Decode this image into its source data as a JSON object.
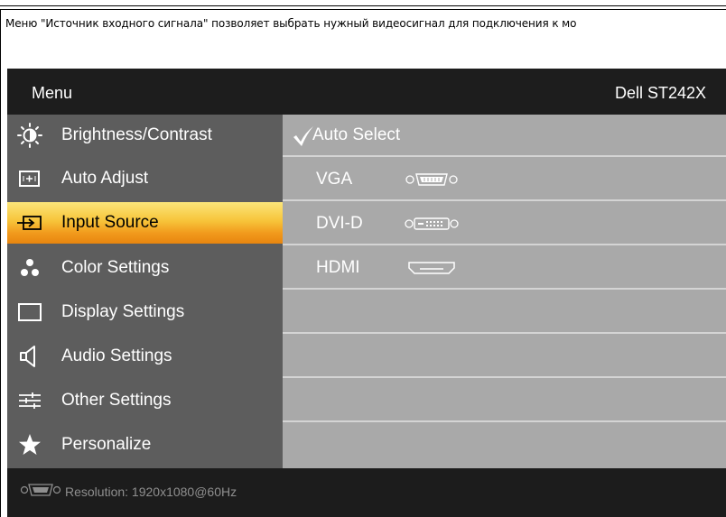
{
  "caption": "Меню \"Источник входного сигнала\" позволяет выбрать нужный видеосигнал для подключения к мо",
  "osd": {
    "header": {
      "title": "Menu",
      "model": "Dell ST242X"
    },
    "menu": [
      {
        "label": "Brightness/Contrast",
        "icon": "brightness-icon",
        "active": false
      },
      {
        "label": "Auto Adjust",
        "icon": "auto-adjust-icon",
        "active": false
      },
      {
        "label": "Input Source",
        "icon": "input-source-icon",
        "active": true
      },
      {
        "label": "Color Settings",
        "icon": "color-settings-icon",
        "active": false
      },
      {
        "label": "Display Settings",
        "icon": "display-settings-icon",
        "active": false
      },
      {
        "label": "Audio Settings",
        "icon": "speaker-icon",
        "active": false
      },
      {
        "label": "Other Settings",
        "icon": "sliders-icon",
        "active": false
      },
      {
        "label": "Personalize",
        "icon": "star-icon",
        "active": false
      }
    ],
    "options": [
      {
        "label": "Auto Select",
        "selected": true,
        "connector": ""
      },
      {
        "label": "VGA",
        "selected": false,
        "connector": "vga-connector-icon"
      },
      {
        "label": "DVI-D",
        "selected": false,
        "connector": "dvi-connector-icon"
      },
      {
        "label": "HDMI",
        "selected": false,
        "connector": "hdmi-connector-icon"
      }
    ],
    "footer": {
      "status": "Resolution:  1920x1080@60Hz",
      "icon": "vga-connector-icon"
    }
  },
  "colors": {
    "osd_background": "#1c1c1c",
    "menu_panel": "#5d5d5d",
    "options_panel": "#a9a9a9",
    "active_highlight": "#f19a1c",
    "footer_text": "#8f8f8f"
  }
}
